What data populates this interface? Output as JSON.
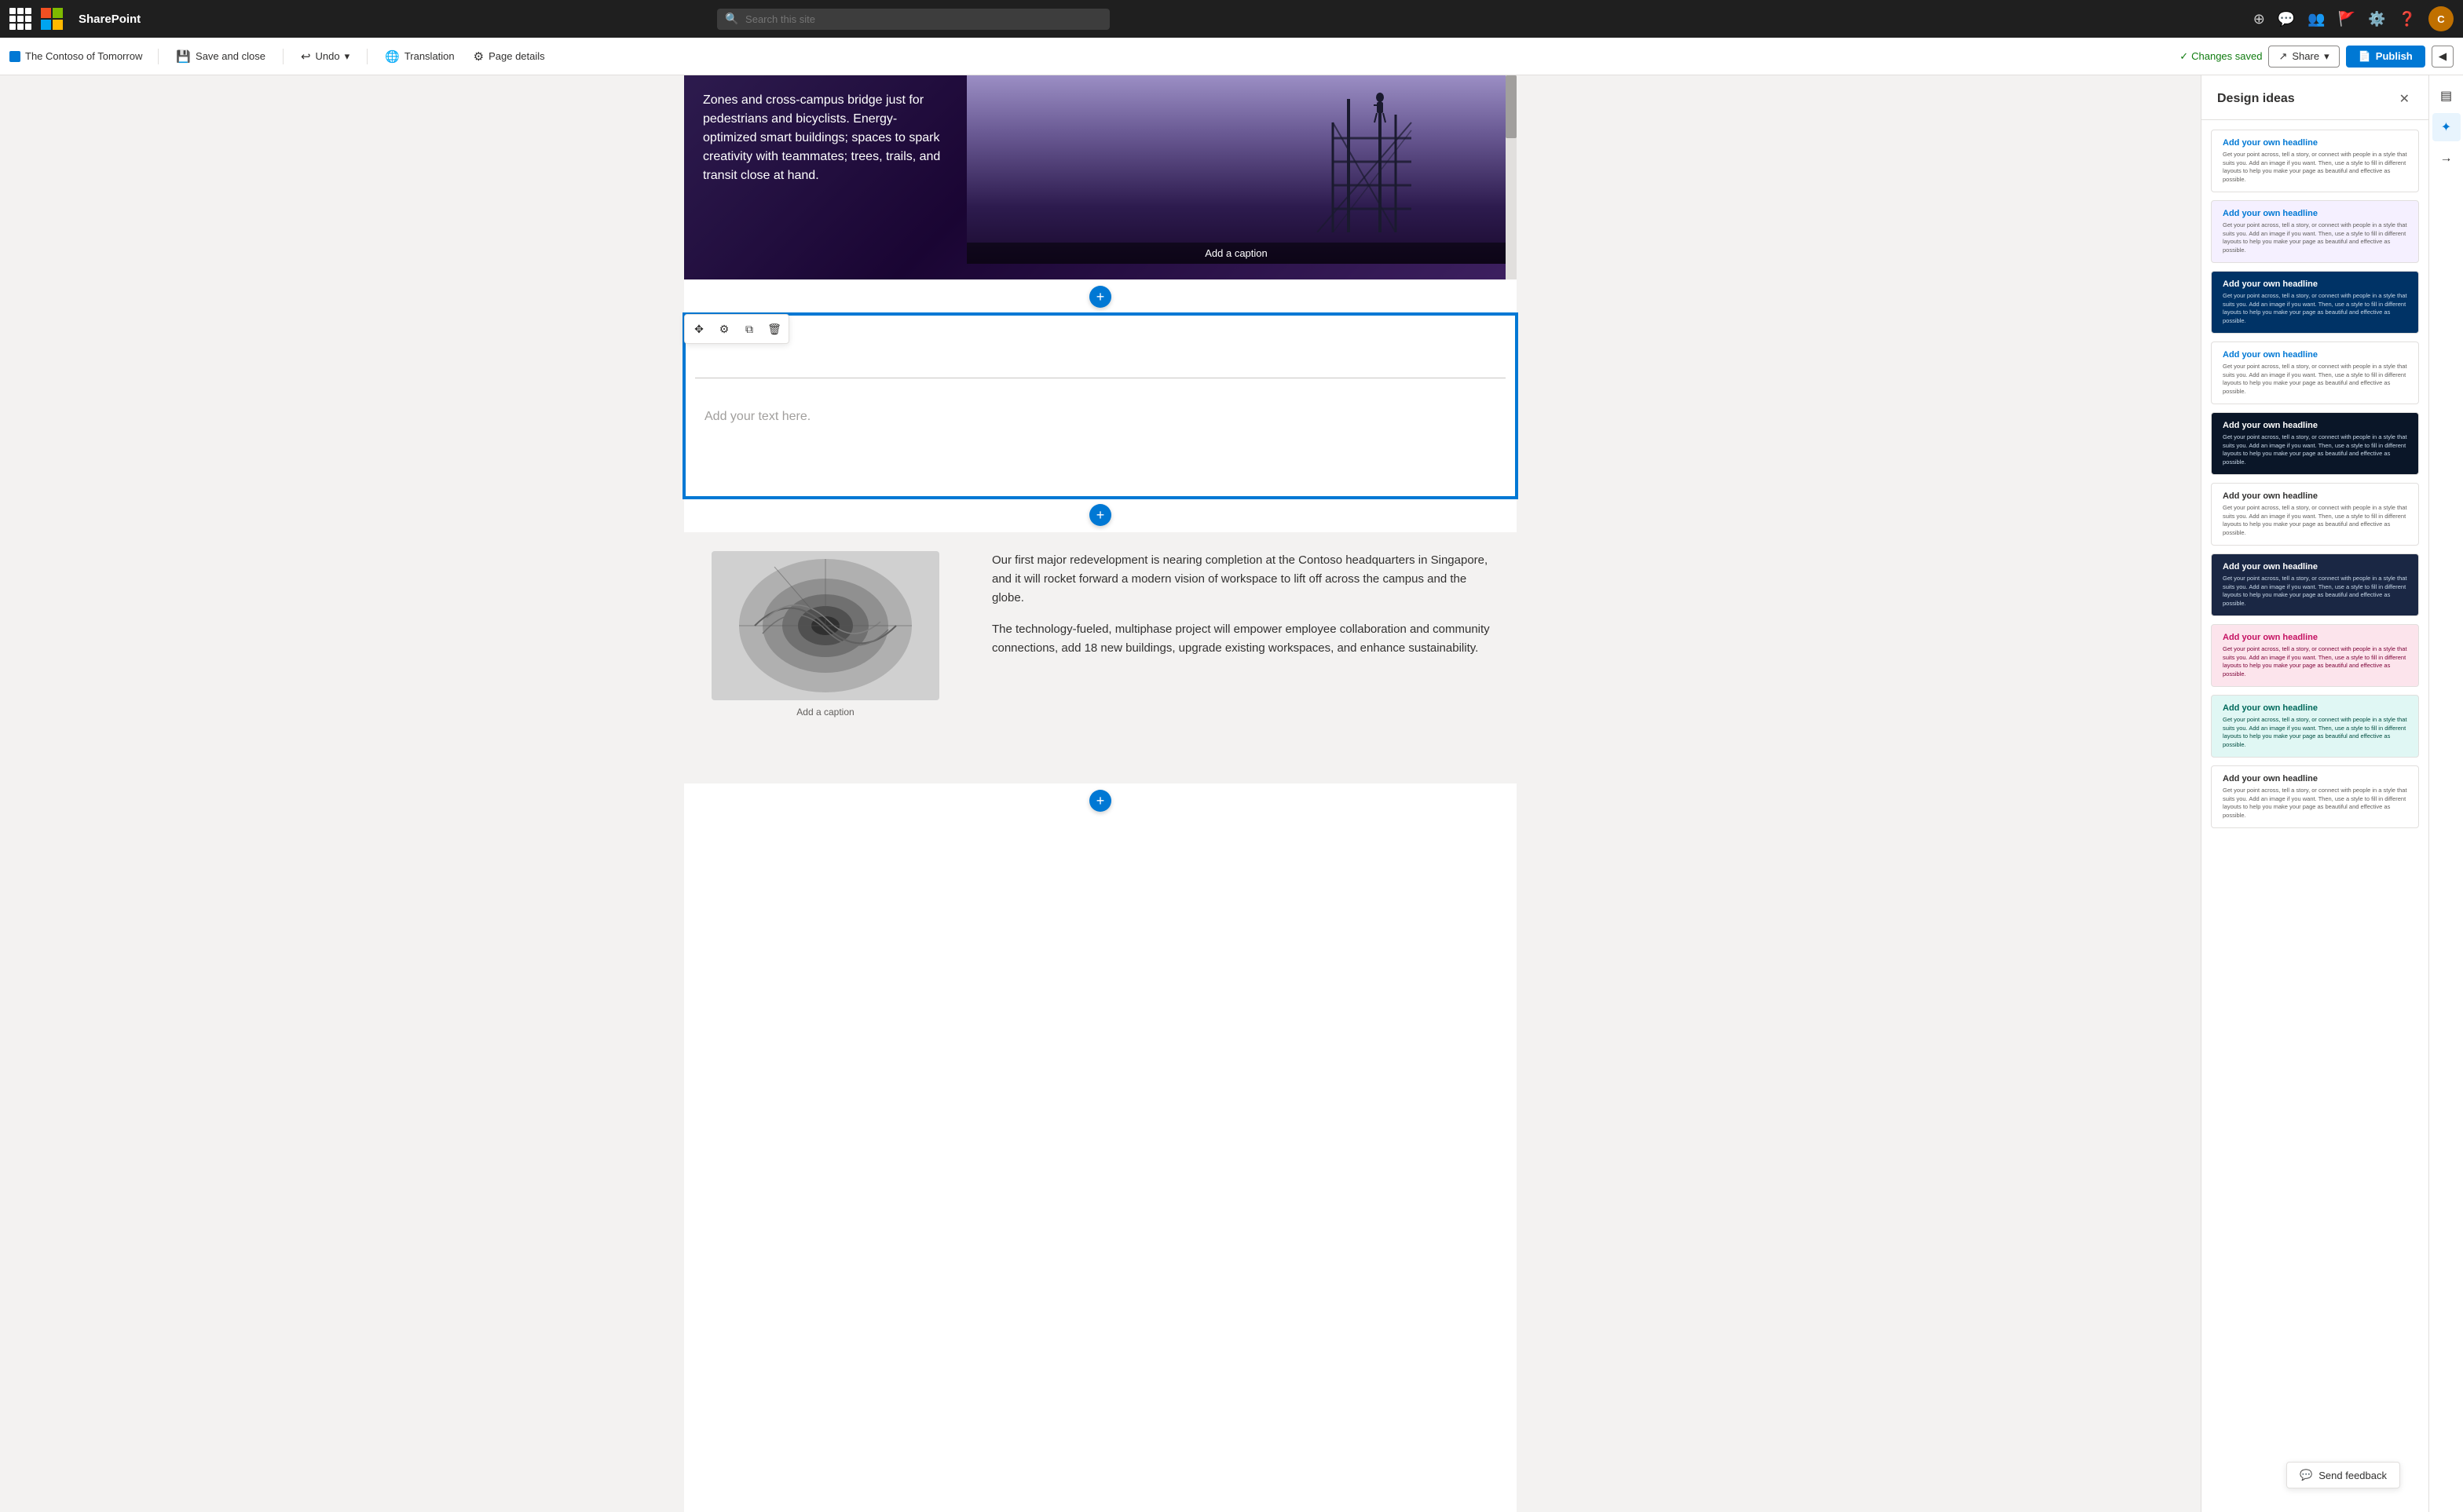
{
  "app": {
    "brand": "SharePoint",
    "ms_product": "Microsoft"
  },
  "nav": {
    "search_placeholder": "Search this site",
    "icons": [
      "copilot",
      "chat",
      "people",
      "flag",
      "settings",
      "help"
    ]
  },
  "toolbar": {
    "page_name": "The Contoso of Tomorrow",
    "save_close_label": "Save and close",
    "undo_label": "Undo",
    "translation_label": "Translation",
    "page_details_label": "Page details",
    "changes_saved_label": "Changes saved",
    "share_label": "Share",
    "publish_label": "Publish"
  },
  "hero": {
    "text": "Zones and cross-campus bridge just for pedestrians and bicyclists. Energy-optimized smart buildings; spaces to spark creativity with teammates; trees, trails, and transit close at hand.",
    "caption": "Add a caption"
  },
  "text_block": {
    "placeholder": "Add your text here."
  },
  "two_col": {
    "image_caption": "Add a caption",
    "para1": "Our first major redevelopment is nearing completion at the Contoso headquarters in Singapore, and it will rocket forward a modern vision of workspace to lift off across the campus and the globe.",
    "para2": "The technology-fueled, multiphase project will empower employee collaboration and community connections, add 18 new buildings, upgrade existing workspaces, and enhance sustainability."
  },
  "design_ideas": {
    "panel_title": "Design ideas",
    "cards": [
      {
        "id": 1,
        "style": "white",
        "headline": "Add your own headline",
        "body": "Get your point across, tell a story, or connect with people in a style that suits you. Add an image if you want. Then, use a style to fill in different layouts to help you make your page as beautiful and effective as possible.",
        "bg": "#ffffff",
        "headline_color": "#0078d4",
        "body_color": "#605e5c"
      },
      {
        "id": 2,
        "style": "light-pink",
        "headline": "Add your own headline",
        "body": "Get your point across, tell a story, or connect with people in a style that suits you. Add an image if you want. Then, use a style to fill in different layouts to help you make your page as beautiful and effective as possible.",
        "bg": "#f5f0ff",
        "headline_color": "#0078d4",
        "body_color": "#605e5c"
      },
      {
        "id": 3,
        "style": "dark-blue",
        "headline": "Add your own headline",
        "body": "Get your point across, tell a story, or connect with people in a style that suits you. Add an image if you want. Then, use a style to fill in different layouts to help you make your page as beautiful and effective as possible.",
        "bg": "#003366",
        "headline_color": "#ffffff",
        "body_color": "#c8d8e8"
      },
      {
        "id": 4,
        "style": "white-2",
        "headline": "Add your own headline",
        "body": "Get your point across, tell a story, or connect with people in a style that suits you. Add an image if you want. Then, use a style to fill in different layouts to help you make your page as beautiful and effective as possible.",
        "bg": "#ffffff",
        "headline_color": "#0078d4",
        "body_color": "#605e5c"
      },
      {
        "id": 5,
        "style": "navy",
        "headline": "Add your own headline",
        "body": "Get your point across, tell a story, or connect with people in a style that suits you. Add an image if you want. Then, use a style to fill in different layouts to help you make your page as beautiful and effective as possible.",
        "bg": "#0a1628",
        "headline_color": "#ffffff",
        "body_color": "#c8d8e8"
      },
      {
        "id": 6,
        "style": "white-3",
        "headline": "Add your own headline",
        "body": "Get your point across, tell a story, or connect with people in a style that suits you. Add an image if you want. Then, use a style to fill in different layouts to help you make your page as beautiful and effective as possible.",
        "bg": "#ffffff",
        "headline_color": "#323130",
        "body_color": "#605e5c"
      },
      {
        "id": 7,
        "style": "dark-navy",
        "headline": "Add your own headline",
        "body": "Get your point across, tell a story, or connect with people in a style that suits you. Add an image if you want. Then, use a style to fill in different layouts to help you make your page as beautiful and effective as possible.",
        "bg": "#1a2744",
        "headline_color": "#ffffff",
        "body_color": "#c8d8e8"
      },
      {
        "id": 8,
        "style": "pink",
        "headline": "Add your own headline",
        "body": "Get your point across, tell a story, or connect with people in a style that suits you. Add an image if you want. Then, use a style to fill in different layouts to help you make your page as beautiful and effective as possible.",
        "bg": "#fce4ec",
        "headline_color": "#c51162",
        "body_color": "#7b0036"
      },
      {
        "id": 9,
        "style": "teal",
        "headline": "Add your own headline",
        "body": "Get your point across, tell a story, or connect with people in a style that suits you. Add an image if you want. Then, use a style to fill in different layouts to help you make your page as beautiful and effective as possible.",
        "bg": "#e0f7f4",
        "headline_color": "#00695c",
        "body_color": "#004d40"
      },
      {
        "id": 10,
        "style": "white-4",
        "headline": "Add your own headline",
        "body": "Get your point across, tell a story, or connect with people in a style that suits you. Add an image if you want. Then, use a style to fill in different layouts to help you make your page as beautiful and effective as possible.",
        "bg": "#ffffff",
        "headline_color": "#323130",
        "body_color": "#605e5c"
      }
    ]
  },
  "feedback": {
    "label": "Send feedback"
  }
}
